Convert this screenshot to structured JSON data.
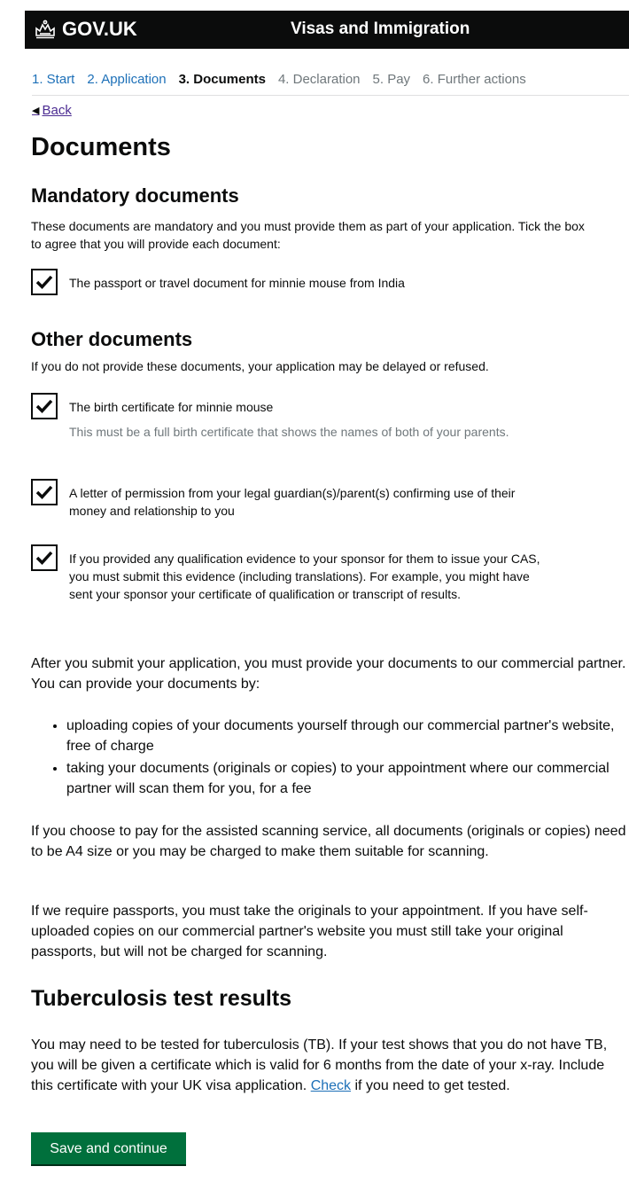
{
  "header": {
    "brand": "GOV.UK",
    "service_name": "Visas and Immigration"
  },
  "steps": [
    {
      "label": "1. Start",
      "state": "done"
    },
    {
      "label": "2. Application",
      "state": "done"
    },
    {
      "label": "3. Documents",
      "state": "current"
    },
    {
      "label": "4. Declaration",
      "state": "todo"
    },
    {
      "label": "5. Pay",
      "state": "todo"
    },
    {
      "label": "6. Further actions",
      "state": "todo"
    }
  ],
  "back_label": "Back",
  "page_title": "Documents",
  "mandatory": {
    "heading": "Mandatory documents",
    "intro": "These documents are mandatory and you must provide them as part of your application. Tick the box to agree that you will provide each document:",
    "items": [
      {
        "label": "The passport or travel document for minnie mouse from India",
        "checked": true
      }
    ]
  },
  "other": {
    "heading": "Other documents",
    "intro": "If you do not provide these documents, your application may be delayed or refused.",
    "items": [
      {
        "label": "The birth certificate for minnie mouse",
        "hint": "This must be a full birth certificate that shows the names of both of your parents.",
        "checked": true
      },
      {
        "label": "A letter of permission from your legal guardian(s)/parent(s) confirming use of their money and relationship to you",
        "checked": true
      },
      {
        "label": "If you provided any qualification evidence to your sponsor for them to issue your CAS, you must submit this evidence (including translations). For example, you might have sent your sponsor your certificate of qualification or transcript of results.",
        "checked": true
      }
    ]
  },
  "submission": {
    "intro": "After you submit your application, you must provide your documents to our commercial partner. You can provide your documents by:",
    "bullets": [
      "uploading copies of your documents yourself through our commercial partner's website, free of charge",
      "taking your documents (originals or copies) to your appointment where our commercial partner will scan them for you, for a fee"
    ],
    "assisted": "If you choose to pay for the assisted scanning service, all documents (originals or copies) need to be A4 size or you may be charged to make them suitable for scanning.",
    "passports": "If we require passports, you must take the originals to your appointment. If you have self-uploaded copies on our commercial partner's website you must still take your original passports, but will not be charged for scanning."
  },
  "tb": {
    "heading": "Tuberculosis test results",
    "text_before_link": "You may need to be tested for tuberculosis (TB). If your test shows that you do not have TB, you will be given a certificate which is valid for 6 months from the date of your x-ray. Include this certificate with your UK visa application. ",
    "link": "Check",
    "text_after_link": " if you need to get tested."
  },
  "button": "Save and continue",
  "colors": {
    "header_bg": "#0b0c0c",
    "link": "#1d70b8",
    "visited_link": "#4c2c92",
    "button": "#00703c",
    "hint": "#6f777b"
  }
}
